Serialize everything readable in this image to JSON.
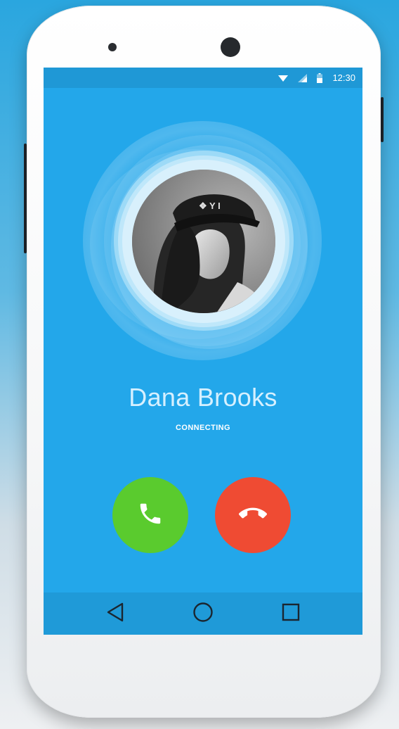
{
  "status_bar": {
    "time": "12:30",
    "icons": [
      "wifi-icon",
      "signal-icon",
      "battery-icon"
    ]
  },
  "call": {
    "caller_name": "Dana Brooks",
    "status": "CONNECTING"
  },
  "actions": {
    "answer_icon": "phone-icon",
    "decline_icon": "phone-hangup-icon"
  },
  "nav_bar": {
    "icons": [
      "back-icon",
      "home-icon",
      "recents-icon"
    ]
  },
  "colors": {
    "screen_background": "#23a7ea",
    "answer_button": "#5acb2e",
    "decline_button": "#ef4b33",
    "caller_name_text": "#d6f0ff"
  }
}
